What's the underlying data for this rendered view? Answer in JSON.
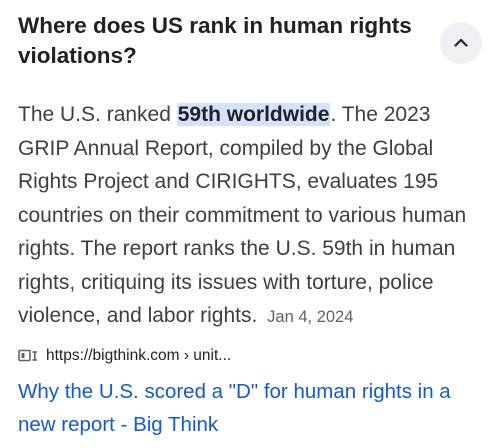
{
  "question": {
    "text": "Where does US rank in human rights violations?",
    "collapse_icon": "chevron-up-icon"
  },
  "answer": {
    "before_highlight": "The U.S. ranked ",
    "highlight": "59th worldwide",
    "after_highlight": ". The 2023 GRIP Annual Report, compiled by the Global Rights Project and CIRIGHTS, evaluates 195 countries on their commitment to various human rights. The report ranks the U.S. 59th in human rights, critiquing its issues with torture, police violence, and labor rights.",
    "date": "Jan 4, 2024"
  },
  "source": {
    "icon": "reader-mode-icon",
    "url": "https://bigthink.com › unit..."
  },
  "result": {
    "title": "Why the U.S. scored a \"D\" for human rights in a new report - Big Think"
  },
  "colors": {
    "highlight_bg": "#d3e3fd",
    "link": "#1558d6",
    "text": "#3c4043",
    "heading": "#202124",
    "button_bg": "#eef0f3"
  }
}
